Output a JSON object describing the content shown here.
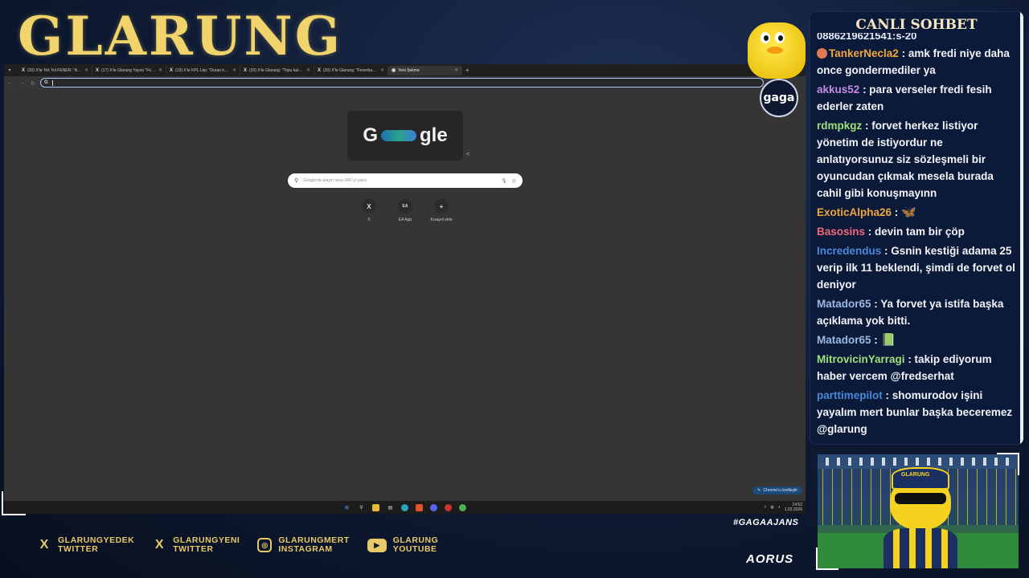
{
  "overlay": {
    "brand": "GLARUNG",
    "hashtag": "#GAGAAJANS",
    "gaga_badge": "gaga",
    "aorus": "AORUS"
  },
  "browser": {
    "tabs": [
      {
        "label": "(20) X'te Tek Yol FENER: \"Avrup…"
      },
      {
        "label": "(17) X'te Glarung Yayını \"Fener…"
      },
      {
        "label": "(19) X'te KPL Lkp: \"Duran kas ol…"
      },
      {
        "label": "(20) X'te Glarung: \"Topu kalep…"
      },
      {
        "label": "(20) X'te Glarung: \"Fenerbahçe…"
      },
      {
        "label": "Yeni Sekme"
      }
    ],
    "doodle": {
      "left": "G",
      "right": "gle"
    },
    "search_placeholder": "Google'da arayın veya URL'yi yazın",
    "shortcuts": [
      {
        "icon": "X",
        "label": "X"
      },
      {
        "icon": "EA",
        "label": "EA App"
      },
      {
        "icon": "+",
        "label": "Kısayol ekle"
      }
    ],
    "customize_label": "Chrome'u özelleştir",
    "clock_time": "14:52",
    "clock_date": "1.02.2026"
  },
  "chat": {
    "title": "CANLI SOHBET",
    "cut_line": "0886219621541:s-20",
    "messages": [
      {
        "user": "TankerNecla2",
        "color": "#f0a640",
        "text": ": amk fredi niye daha once gondermediler ya",
        "avatar": true
      },
      {
        "user": "akkus52",
        "color": "#c58be0",
        "text": ": para verseler fredi fesih ederler zaten"
      },
      {
        "user": "rdmpkgz",
        "color": "#9ee07a",
        "text": ": forvet herkez listiyor yönetim de istiyordur ne anlatıyorsunuz siz sözleşmeli bir oyuncudan çıkmak mesela burada cahil gibi konuşmayınn"
      },
      {
        "user": "ExoticAlpha26",
        "color": "#f0a640",
        "text": ": ",
        "emote": "🦋"
      },
      {
        "user": "Basosins",
        "color": "#f06878",
        "text": ": devin tam bir çöp"
      },
      {
        "user": "Incredendus",
        "color": "#4a88d8",
        "text": ": Gsnin kestiği adama 25 verip ilk 11 beklendi, şimdi de forvet ol deniyor"
      },
      {
        "user": "Matador65",
        "color": "#9bb8e0",
        "text": ": Ya forvet ya istifa başka açıklama yok bitti."
      },
      {
        "user": "Matador65",
        "color": "#9bb8e0",
        "text": ": ",
        "emote": "📗"
      },
      {
        "user": "MitrovicinYarragi",
        "color": "#9ee07a",
        "text": ": takip ediyorum haber vercem @fredserhat"
      },
      {
        "user": "parttimepilot",
        "color": "#4a88d8",
        "text": ": shomurodov işini yayalım mert bunlar başka beceremez @glarung"
      }
    ]
  },
  "webcam": {
    "cap_text": "GLARUNG"
  },
  "social": [
    {
      "icon": "x-icon",
      "glyph": "X",
      "line1": "GLARUNGYEDEK",
      "line2": "TWITTER"
    },
    {
      "icon": "x-icon",
      "glyph": "X",
      "line1": "GLARUNGYENI",
      "line2": "TWITTER"
    },
    {
      "icon": "instagram-icon",
      "glyph": "◎",
      "line1": "GLARUNGMERT",
      "line2": "INSTAGRAM"
    },
    {
      "icon": "youtube-icon",
      "glyph": "▶",
      "line1": "GLARUNG",
      "line2": "YOUTUBE"
    }
  ]
}
